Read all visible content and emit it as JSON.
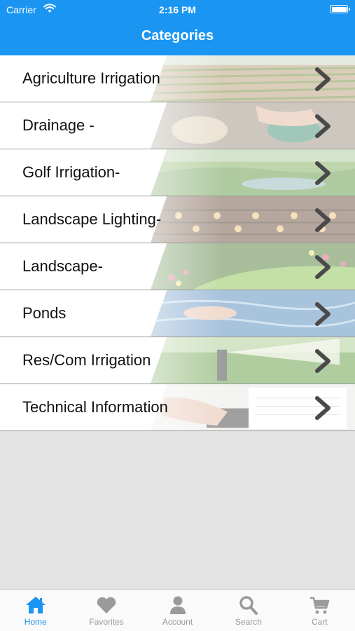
{
  "status_bar": {
    "carrier": "Carrier",
    "time": "2:16 PM"
  },
  "nav": {
    "title": "Categories"
  },
  "categories": [
    {
      "label": "Agriculture Irrigation",
      "image": "crop-field-photo"
    },
    {
      "label": "Drainage -",
      "image": "drain-grate-photo"
    },
    {
      "label": "Golf Irrigation-",
      "image": "golf-course-photo"
    },
    {
      "label": "Landscape Lighting-",
      "image": "deck-lights-photo"
    },
    {
      "label": "Landscape-",
      "image": "garden-photo"
    },
    {
      "label": "Ponds",
      "image": "water-hands-photo"
    },
    {
      "label": "Res/Com Irrigation",
      "image": "sprinkler-photo"
    },
    {
      "label": "Technical Information",
      "image": "calculator-paper-photo"
    }
  ],
  "tabbar": {
    "items": [
      {
        "label": "Home",
        "icon": "home-icon",
        "active": true
      },
      {
        "label": "Favorites",
        "icon": "heart-icon",
        "active": false
      },
      {
        "label": "Account",
        "icon": "person-icon",
        "active": false
      },
      {
        "label": "Search",
        "icon": "search-icon",
        "active": false
      },
      {
        "label": "Cart",
        "icon": "cart-icon",
        "active": false
      }
    ]
  },
  "colors": {
    "accent": "#1b95f2",
    "tab_inactive": "#9a9a9a",
    "background": "#e3e3e3"
  }
}
